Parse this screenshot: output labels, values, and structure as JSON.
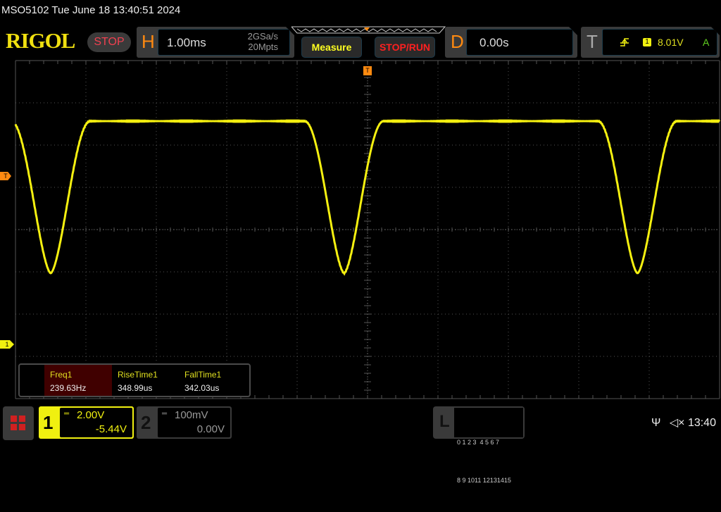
{
  "header": {
    "title": "MSO5102  Tue June 18 13:40:51 2024",
    "logo": "RIGOL",
    "run_state": "STOP"
  },
  "horizontal": {
    "letter": "H",
    "timebase": "1.00ms",
    "sample_rate": "2GSa/s",
    "memory_depth": "20Mpts"
  },
  "buttons": {
    "measure": "Measure",
    "stop_run": "STOP/RUN"
  },
  "delay": {
    "letter": "D",
    "value": "0.00s"
  },
  "trigger": {
    "letter": "T",
    "slope_icon": "rising-edge-icon",
    "source": "1",
    "level": "8.01V",
    "mode": "A"
  },
  "markers": {
    "trigger_level": "T",
    "channel1_ground": "1",
    "trigger_position": "T"
  },
  "measurements": [
    {
      "name": "Freq1",
      "value": "239.63Hz"
    },
    {
      "name": "RiseTime1",
      "value": "348.99us"
    },
    {
      "name": "FallTime1",
      "value": "342.03us"
    }
  ],
  "channels": [
    {
      "number": "1",
      "coupling_icon": "dc-coupling-icon",
      "scale": "2.00V",
      "offset": "-5.44V",
      "active": true
    },
    {
      "number": "2",
      "coupling_icon": "dc-coupling-icon",
      "scale": "100mV",
      "offset": "0.00V",
      "active": false
    }
  ],
  "logic": {
    "letter": "L",
    "row1": "0 1 2 3  4 5 6 7",
    "row2": "8 9 1011 12131415"
  },
  "status": {
    "usb_icon": "usb-icon",
    "mute_icon": "speaker-muted-icon",
    "time": "13:40"
  },
  "colors": {
    "ch1": "#f0f010",
    "accent": "#ff8a10",
    "stop": "#f04050"
  }
}
